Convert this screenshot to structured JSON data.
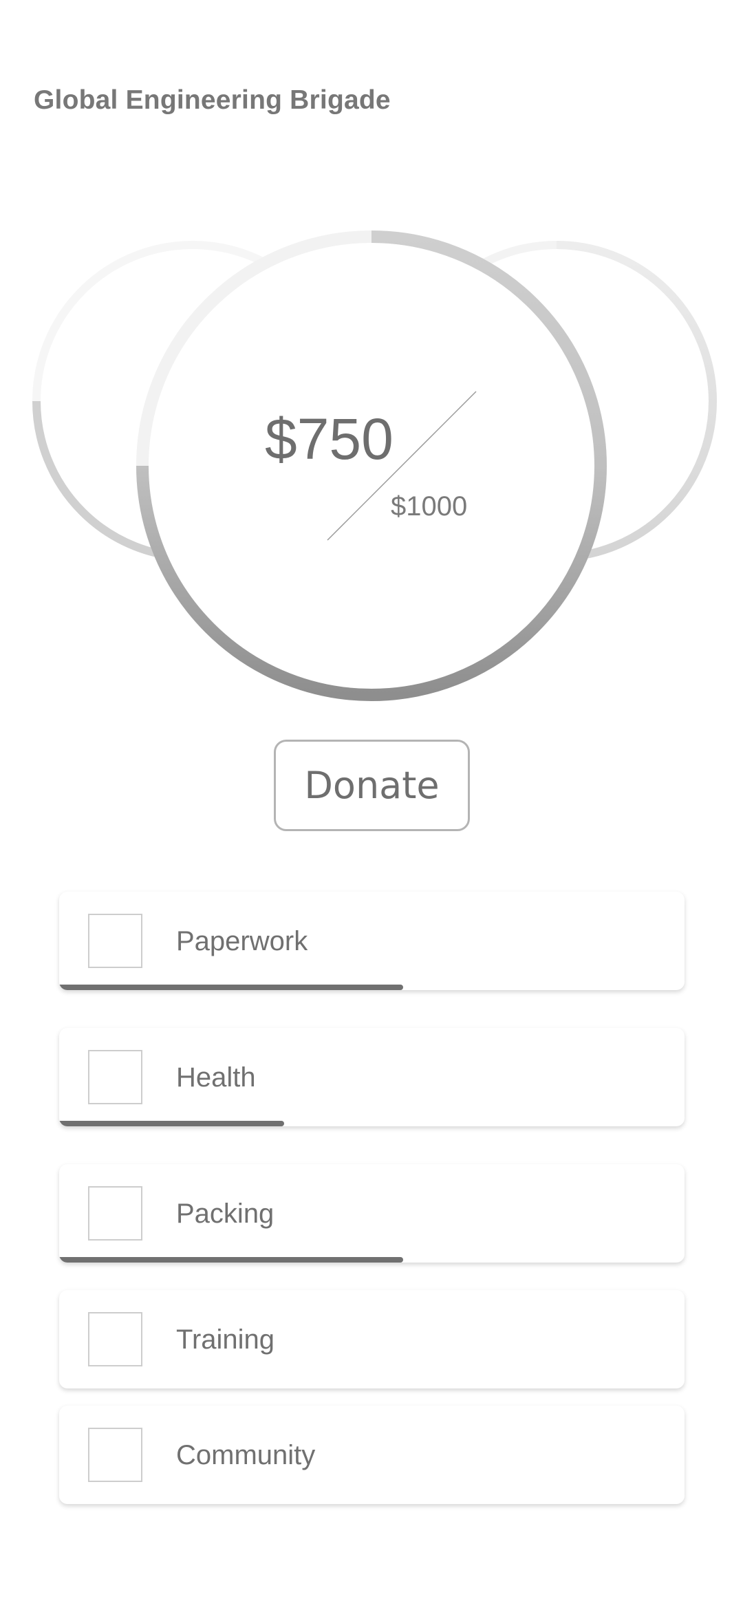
{
  "header": {
    "title": "Global Engineering Brigade"
  },
  "fundraising": {
    "raised_label": "$750",
    "goal_label": "$1000",
    "raised": 750,
    "goal": 1000
  },
  "donate_button": {
    "label": "Donate"
  },
  "tasks": [
    {
      "label": "Paperwork",
      "progress": 0.55
    },
    {
      "label": "Health",
      "progress": 0.36
    },
    {
      "label": "Packing",
      "progress": 0.55
    },
    {
      "label": "Training",
      "progress": 0
    },
    {
      "label": "Community",
      "progress": 0
    }
  ],
  "colors": {
    "text": "#707070",
    "progress": "#707070",
    "ring_track": "#f2f2f2",
    "ring_fill_light": "#d0d0d0",
    "ring_fill_dark": "#8c8c8c"
  }
}
